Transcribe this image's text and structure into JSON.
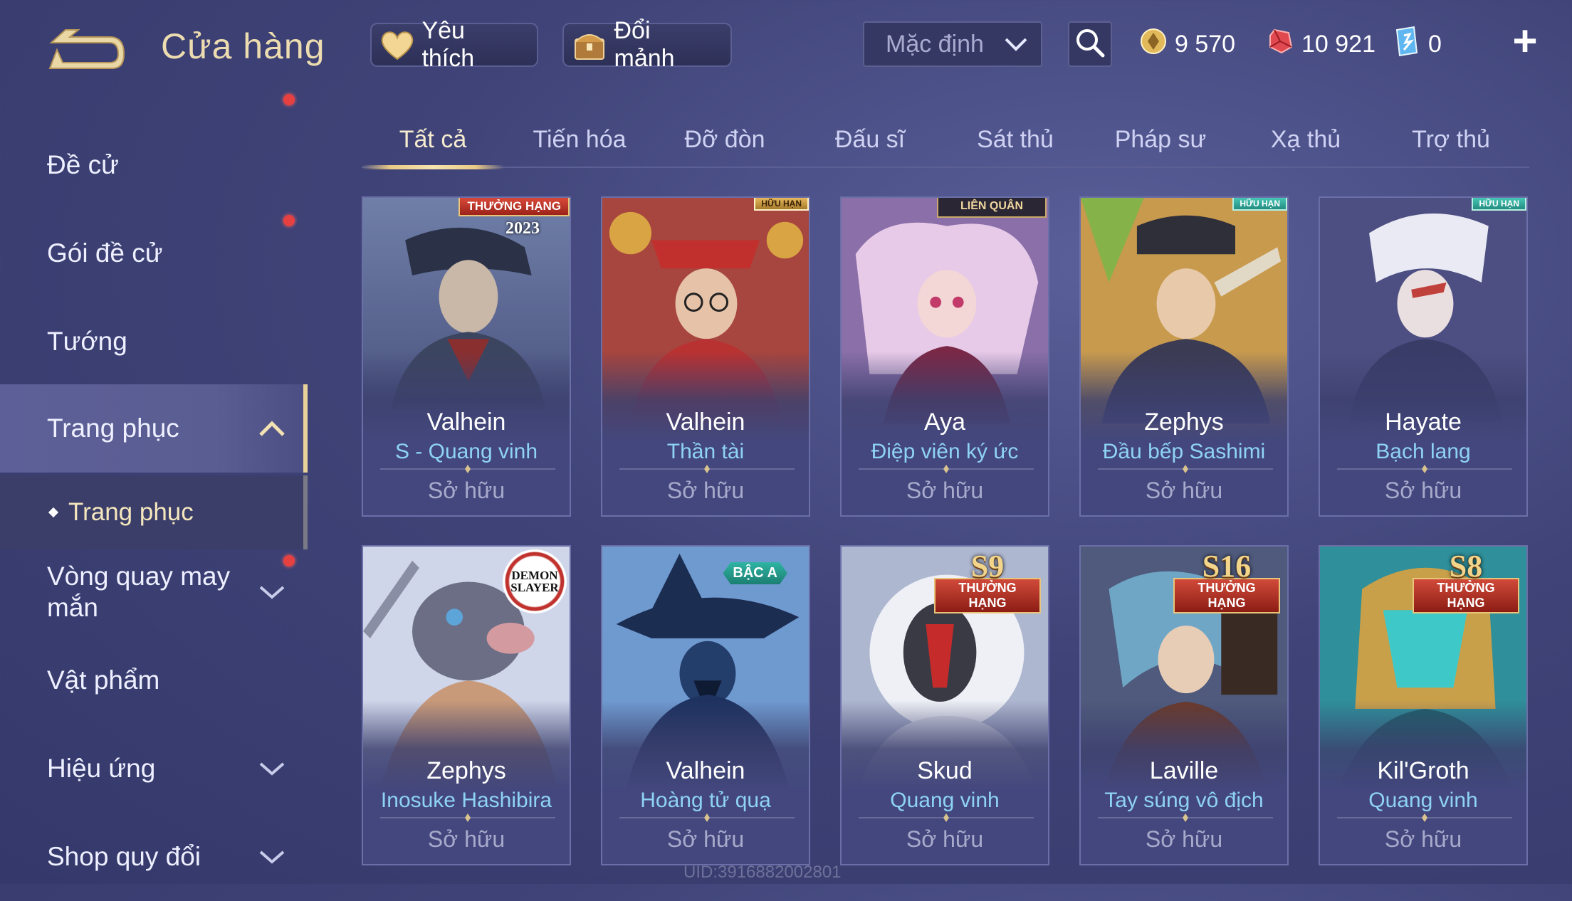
{
  "header": {
    "title": "Cửa hàng",
    "favorite_label": "Yêu thích",
    "shard_label": "Đổi mảnh",
    "sort_value": "Mặc định",
    "currency": {
      "gold": "9 570",
      "ruby": "10 921",
      "voucher": "0"
    }
  },
  "sidebar": {
    "items": [
      {
        "label": "Đề cử"
      },
      {
        "label": "Gói đề cử"
      },
      {
        "label": "Tướng"
      },
      {
        "label": "Trang phục"
      },
      {
        "label": "Vòng quay may mắn"
      },
      {
        "label": "Vật phẩm"
      },
      {
        "label": "Hiệu ứng"
      },
      {
        "label": "Shop quy đổi"
      }
    ],
    "sub_item": "Trang phục"
  },
  "tabs": [
    "Tất cả",
    "Tiến hóa",
    "Đỡ đòn",
    "Đấu sĩ",
    "Sát thủ",
    "Pháp sư",
    "Xạ thủ",
    "Trợ thủ"
  ],
  "cards": [
    {
      "hero": "Valhein",
      "skin": "S - Quang vinh",
      "status": "Sở hữu",
      "badge": "THƯỞNG HẠNG",
      "year": "2023"
    },
    {
      "hero": "Valhein",
      "skin": "Thần tài",
      "status": "Sở hữu",
      "badge": "HỮU HẠN"
    },
    {
      "hero": "Aya",
      "skin": "Điệp viên ký ức",
      "status": "Sở hữu",
      "badge": "LIÊN QUÂN"
    },
    {
      "hero": "Zephys",
      "skin": "Đầu bếp Sashimi",
      "status": "Sở hữu",
      "badge": "HỮU HẠN"
    },
    {
      "hero": "Hayate",
      "skin": "Bạch lang",
      "status": "Sở hữu",
      "badge": "HỮU HẠN"
    },
    {
      "hero": "Zephys",
      "skin": "Inosuke Hashibira",
      "status": "Sở hữu",
      "badge": "DEMON SLAYER"
    },
    {
      "hero": "Valhein",
      "skin": "Hoàng tử quạ",
      "status": "Sở hữu",
      "badge": "BẬC A"
    },
    {
      "hero": "Skud",
      "skin": "Quang vinh",
      "status": "Sở hữu",
      "season": "S9",
      "badge": "THƯỞNG HẠNG"
    },
    {
      "hero": "Laville",
      "skin": "Tay súng vô địch",
      "status": "Sở hữu",
      "season": "S16",
      "badge": "THƯỞNG HẠNG"
    },
    {
      "hero": "Kil'Groth",
      "skin": "Quang vinh",
      "status": "Sở hữu",
      "season": "S8",
      "badge": "THƯỞNG HẠNG"
    }
  ],
  "watermark": "UID:3916882002801",
  "colors": {
    "accent": "#e8d29a",
    "skin_name": "#8fd3f4",
    "background": "#3f4377"
  }
}
